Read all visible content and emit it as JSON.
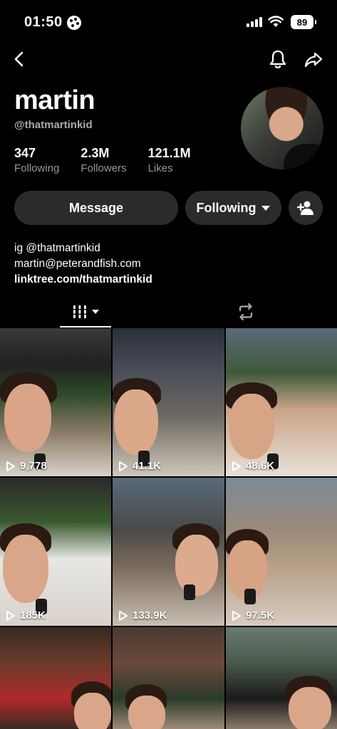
{
  "status_bar": {
    "time": "01:50",
    "battery": "89"
  },
  "profile": {
    "display_name": "martin",
    "username": "@thatmartinkid",
    "stats": [
      {
        "value": "347",
        "label": "Following"
      },
      {
        "value": "2.3M",
        "label": "Followers"
      },
      {
        "value": "121.1M",
        "label": "Likes"
      }
    ],
    "bio": {
      "line1": "ig @thatmartinkid",
      "line2": "martin@peterandfish.com",
      "link": "linktree.com/thatmartinkid"
    }
  },
  "actions": {
    "message_label": "Message",
    "following_label": "Following"
  },
  "icons": {
    "back": "chevron-left-icon",
    "bell": "bell-icon",
    "share": "share-arrow-icon",
    "add_friend": "add-person-icon",
    "grid_tab": "grid-icon",
    "repost_tab": "repost-icon",
    "play": "play-icon"
  },
  "videos": [
    {
      "views": "9,778"
    },
    {
      "views": "41.1K"
    },
    {
      "views": "48.6K"
    },
    {
      "views": "185K"
    },
    {
      "views": "133.9K"
    },
    {
      "views": "97.5K"
    },
    {
      "views": ""
    },
    {
      "views": ""
    },
    {
      "views": ""
    }
  ],
  "colors": {
    "background": "#000000",
    "button": "#2b2b2b",
    "muted_text": "#999999"
  }
}
